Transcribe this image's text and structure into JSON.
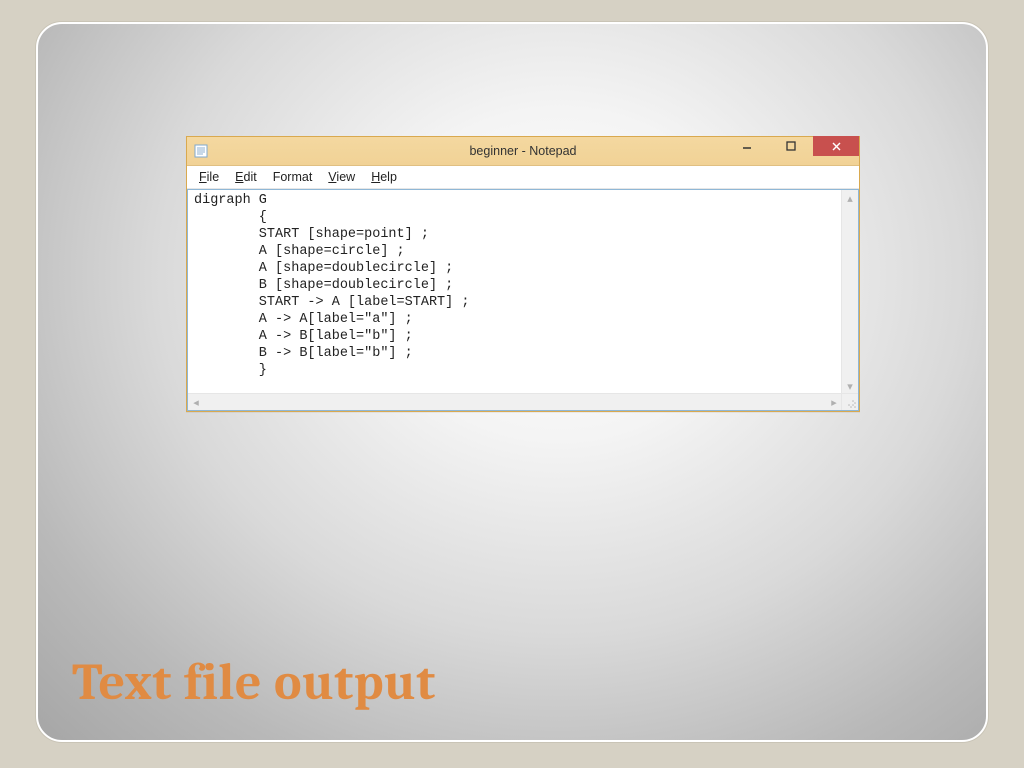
{
  "slide": {
    "title": "Text file output"
  },
  "notepad": {
    "title": "beginner - Notepad",
    "menu": {
      "file": {
        "mnemonic": "F",
        "rest": "ile"
      },
      "edit": {
        "mnemonic": "E",
        "rest": "dit"
      },
      "format": {
        "label": "Format"
      },
      "view": {
        "mnemonic": "V",
        "rest": "iew"
      },
      "help": {
        "mnemonic": "H",
        "rest": "elp"
      }
    },
    "content": "digraph G\n        {\n        START [shape=point] ;\n        A [shape=circle] ;\n        A [shape=doublecircle] ;\n        B [shape=doublecircle] ;\n        START -> A [label=START] ;\n        A -> A[label=\"a\"] ;\n        A -> B[label=\"b\"] ;\n        B -> B[label=\"b\"] ;\n        }"
  }
}
